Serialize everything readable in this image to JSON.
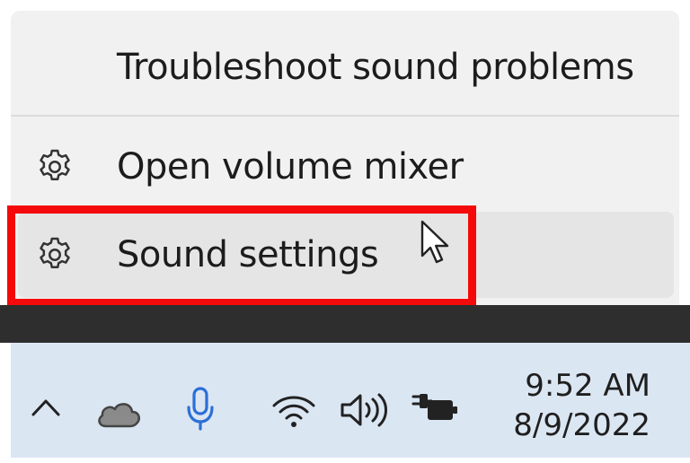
{
  "menu": {
    "items": [
      {
        "label": "Troubleshoot sound problems",
        "icon": ""
      },
      {
        "label": "Open volume mixer",
        "icon": "gear-icon"
      },
      {
        "label": "Sound settings",
        "icon": "gear-icon",
        "hovered": true,
        "highlighted": true
      }
    ]
  },
  "taskbar": {
    "tray_icons": [
      "chevron-up-icon",
      "cloud-icon",
      "microphone-icon",
      "wifi-icon",
      "speaker-icon",
      "battery-plug-icon"
    ],
    "clock": {
      "time": "9:52 AM",
      "date": "8/9/2022"
    }
  },
  "colors": {
    "menu_bg": "#f1f1f1",
    "hover_bg": "#e5e5e5",
    "highlight_box": "#f40a0a",
    "taskbar_bg": "#dbe6f3",
    "mic_accent": "#2b6fd6"
  }
}
